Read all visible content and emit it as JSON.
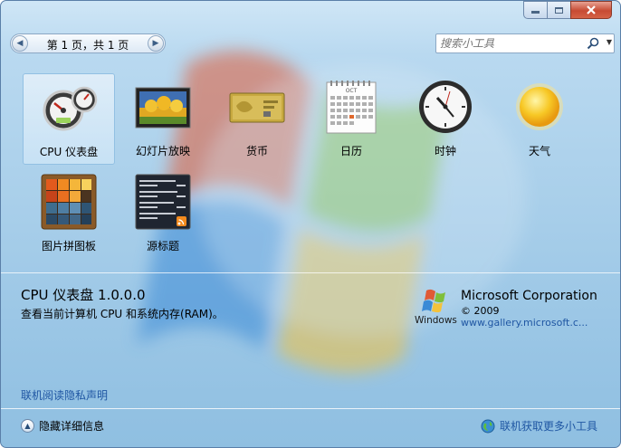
{
  "window": {
    "minimize_icon": "minimize-icon",
    "maximize_icon": "maximize-icon",
    "close_icon": "close-icon"
  },
  "pager": {
    "text": "第 1 页，共 1 页"
  },
  "search": {
    "placeholder": "搜索小工具"
  },
  "gadgets": [
    {
      "label": "CPU 仪表盘",
      "icon": "cpu-meter-icon",
      "selected": true
    },
    {
      "label": "幻灯片放映",
      "icon": "slideshow-icon",
      "selected": false
    },
    {
      "label": "货币",
      "icon": "currency-icon",
      "selected": false
    },
    {
      "label": "日历",
      "icon": "calendar-icon",
      "selected": false
    },
    {
      "label": "时钟",
      "icon": "clock-icon",
      "selected": false
    },
    {
      "label": "天气",
      "icon": "weather-icon",
      "selected": false
    },
    {
      "label": "图片拼图板",
      "icon": "picture-puzzle-icon",
      "selected": false
    },
    {
      "label": "源标题",
      "icon": "feed-headlines-icon",
      "selected": false
    }
  ],
  "details": {
    "title": "CPU 仪表盘 1.0.0.0",
    "description": "查看当前计算机 CPU 和系统内存(RAM)。",
    "publisher": "Microsoft Corporation",
    "copyright": "© 2009",
    "url": "www.gallery.microsoft.c...",
    "logo_text": "Windows"
  },
  "calendar_icon_month": "OCT",
  "privacy_link": "联机阅读隐私声明",
  "hide_details": "隐藏详细信息",
  "get_more": "联机获取更多小工具"
}
